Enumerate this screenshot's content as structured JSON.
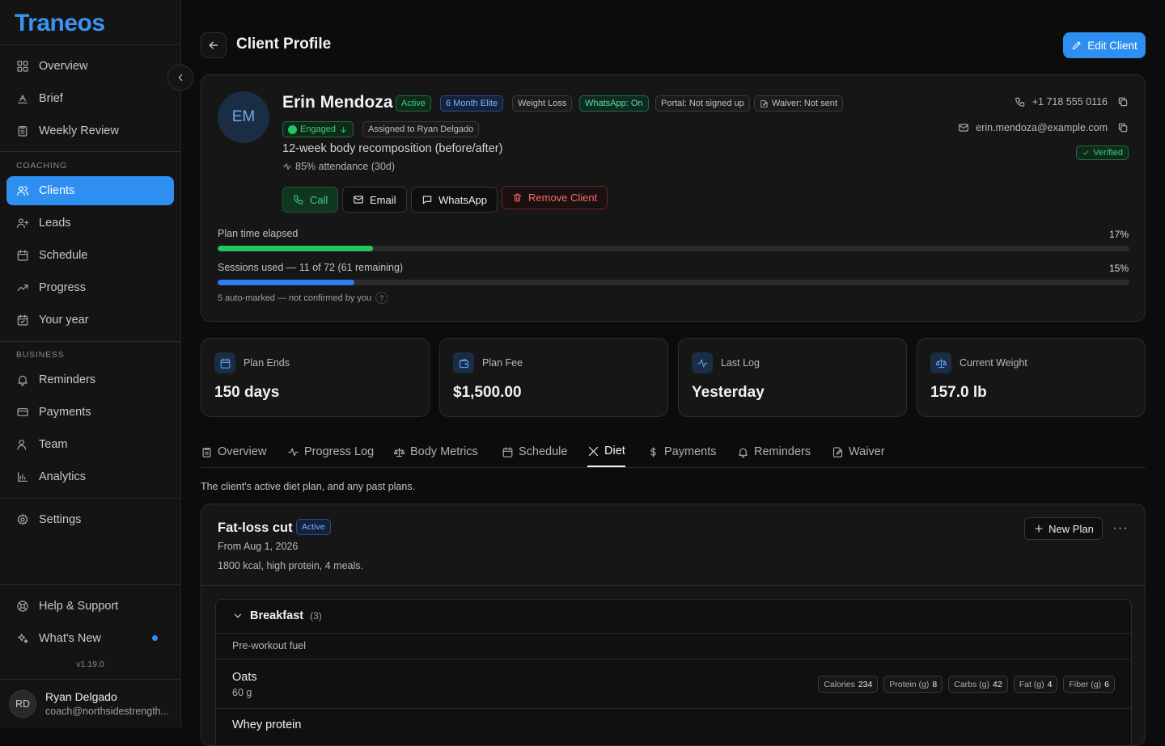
{
  "app": {
    "logo": "Traneos",
    "version": "v1.19.0"
  },
  "sidebar": {
    "main_items": [
      {
        "label": "Overview",
        "icon": "grid-icon"
      },
      {
        "label": "Brief",
        "icon": "brief-icon"
      },
      {
        "label": "Weekly Review",
        "icon": "clipboard-icon"
      }
    ],
    "coaching_label": "COACHING",
    "coaching_items": [
      {
        "label": "Clients",
        "icon": "users-icon",
        "active": true
      },
      {
        "label": "Leads",
        "icon": "user-plus-icon"
      },
      {
        "label": "Schedule",
        "icon": "calendar-icon"
      },
      {
        "label": "Progress",
        "icon": "trending-up-icon"
      },
      {
        "label": "Your year",
        "icon": "calendar-check-icon"
      }
    ],
    "business_label": "BUSINESS",
    "business_items": [
      {
        "label": "Reminders",
        "icon": "bell-icon"
      },
      {
        "label": "Payments",
        "icon": "credit-card-icon"
      },
      {
        "label": "Team",
        "icon": "team-icon"
      },
      {
        "label": "Analytics",
        "icon": "bar-chart-icon"
      }
    ],
    "settings": "Settings",
    "help": "Help & Support",
    "whats_new": "What's New",
    "user": {
      "initials": "RD",
      "name": "Ryan Delgado",
      "email": "coach@northsidestrength..."
    }
  },
  "header": {
    "title": "Client Profile",
    "edit_label": "Edit Client"
  },
  "client": {
    "initials": "EM",
    "name": "Erin Mendoza",
    "badges": [
      "Active",
      "6 Month Elite",
      "Weight Loss",
      "WhatsApp: On",
      "Portal: Not signed up",
      "Waiver: Not sent"
    ],
    "engagement": "Engaged",
    "assigned": "Assigned to Ryan Delgado",
    "goal": "12-week body recomposition (before/after)",
    "attendance": "85% attendance (30d)",
    "phone": "+1 718 555 0116",
    "email": "erin.mendoza@example.com",
    "verified": "Verified",
    "actions": {
      "call": "Call",
      "email": "Email",
      "whatsapp": "WhatsApp",
      "remove": "Remove Client"
    },
    "plan_time": {
      "label": "Plan time elapsed",
      "pct_text": "17%",
      "fraction": 0.17
    },
    "sessions": {
      "label": "Sessions used — 11 of 72 (61 remaining)",
      "pct_text": "15%",
      "fraction": 0.15
    },
    "auto_note": "5 auto-marked — not confirmed by you",
    "help_mark": "?"
  },
  "stats": [
    {
      "label": "Plan Ends",
      "value": "150 days",
      "icon": "calendar-icon"
    },
    {
      "label": "Plan Fee",
      "value": "$1,500.00",
      "icon": "wallet-icon"
    },
    {
      "label": "Last Log",
      "value": "Yesterday",
      "icon": "activity-icon"
    },
    {
      "label": "Current Weight",
      "value": "157.0 lb",
      "icon": "scale-icon"
    }
  ],
  "tabs": [
    "Overview",
    "Progress Log",
    "Body Metrics",
    "Schedule",
    "Diet",
    "Payments",
    "Reminders",
    "Waiver"
  ],
  "active_tab": "Diet",
  "diet": {
    "description": "The client's active diet plan, and any past plans.",
    "plan": {
      "name": "Fat-loss cut",
      "status": "Active",
      "from": "From Aug 1, 2026",
      "desc": "1800 kcal, high protein, 4 meals.",
      "new_plan": "New Plan",
      "more": "···"
    },
    "meal": {
      "title": "Breakfast",
      "count": "(3)",
      "note": "Pre-workout fuel",
      "foods": [
        {
          "name": "Oats",
          "qty": "60 g",
          "macros": [
            {
              "label": "Calories",
              "value": "234"
            },
            {
              "label": "Protein (g)",
              "value": "8"
            },
            {
              "label": "Carbs (g)",
              "value": "42"
            },
            {
              "label": "Fat (g)",
              "value": "4"
            },
            {
              "label": "Fiber (g)",
              "value": "6"
            }
          ]
        },
        {
          "name": "Whey protein"
        }
      ]
    }
  },
  "colors": {
    "accent": "#2f8ff0",
    "success": "#22c55e",
    "danger": "#f36b6b"
  }
}
